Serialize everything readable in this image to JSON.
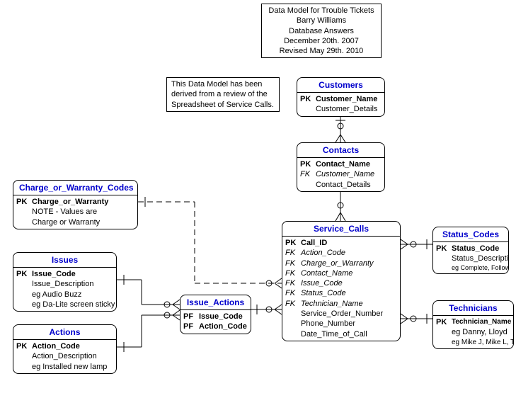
{
  "title_box": {
    "line1": "Data Model for Trouble Tickets",
    "line2": "Barry Williams",
    "line3": "Database Answers",
    "line4": "December 20th. 2007",
    "line5": "Revised May 29th. 2010"
  },
  "note_box": {
    "line1": "This Data Model has been",
    "line2": "derived from a review of the",
    "line3": "Spreadsheet of Service Calls."
  },
  "customers": {
    "title": "Customers",
    "pk": "PK",
    "pk_name": "Customer_Name",
    "attr1": "Customer_Details"
  },
  "contacts": {
    "title": "Contacts",
    "pk": "PK",
    "pk_name": "Contact_Name",
    "fk": "FK",
    "fk_name": "Customer_Name",
    "attr1": "Contact_Details"
  },
  "charge_codes": {
    "title": "Charge_or_Warranty_Codes",
    "pk": "PK",
    "pk_name": "Charge_or_Warranty",
    "note1": "NOTE - Values are",
    "note2": "Charge or Warranty"
  },
  "issues": {
    "title": "Issues",
    "pk": "PK",
    "pk_name": "Issue_Code",
    "attr1": "Issue_Description",
    "attr2": "eg Audio Buzz",
    "attr3": "eg Da-Lite screen sticky"
  },
  "actions": {
    "title": "Actions",
    "pk": "PK",
    "pk_name": "Action_Code",
    "attr1": "Action_Description",
    "attr2": "eg Installed new lamp"
  },
  "issue_actions": {
    "title": "Issue_Actions",
    "pf1": "PF",
    "pf1_name": "Issue_Code",
    "pf2": "PF",
    "pf2_name": "Action_Code"
  },
  "service_calls": {
    "title": "Service_Calls",
    "pk": "PK",
    "pk_name": "Call_ID",
    "fk1": "FK",
    "fk1_name": "Action_Code",
    "fk2": "FK",
    "fk2_name": "Charge_or_Warranty",
    "fk3": "FK",
    "fk3_name": "Contact_Name",
    "fk4": "FK",
    "fk4_name": "Issue_Code",
    "fk5": "FK",
    "fk5_name": "Status_Code",
    "fk6": "FK",
    "fk6_name": "Technician_Name",
    "attr1": "Service_Order_Number",
    "attr2": "Phone_Number",
    "attr3": "Date_Time_of_Call"
  },
  "status_codes": {
    "title": "Status_Codes",
    "pk": "PK",
    "pk_name": "Status_Code",
    "attr1": "Status_Description",
    "attr2": "eg Complete, Follow-up"
  },
  "technicians": {
    "title": "Technicians",
    "pk": "PK",
    "pk_name": "Technician_Name",
    "attr1": "eg Danny, Lloyd",
    "attr2": "eg Mike J, Mike L, TB"
  }
}
